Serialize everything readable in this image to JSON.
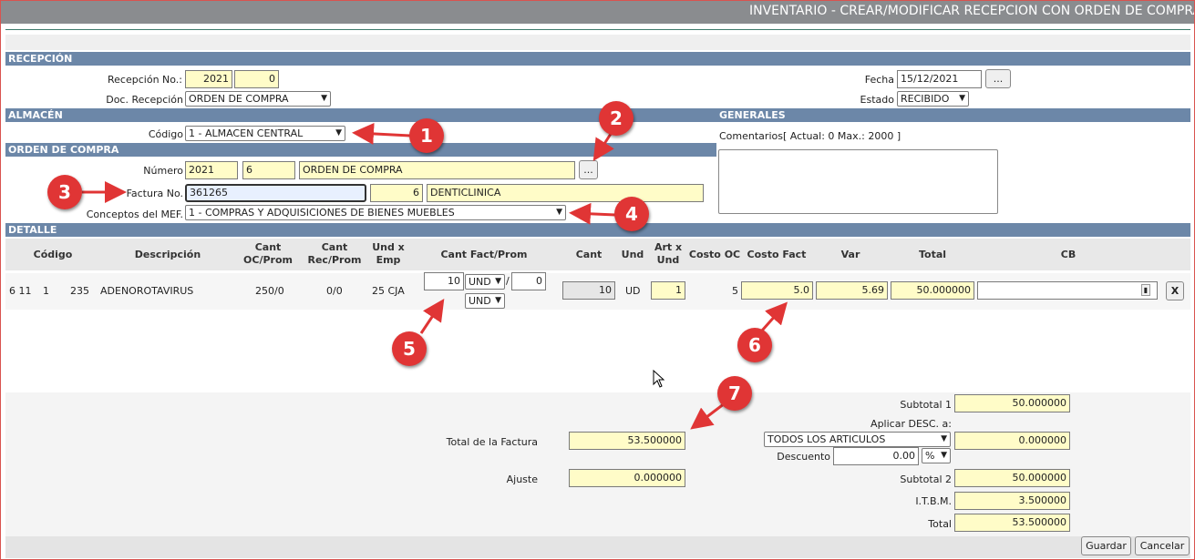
{
  "window": {
    "title": "INVENTARIO - CREAR/MODIFICAR RECEPCION CON ORDEN DE COMPRA"
  },
  "sections": {
    "recepcion": "RECEPCIÓN",
    "almacen": "ALMACÉN",
    "generales": "GENERALES",
    "orden": "ORDEN DE COMPRA",
    "detalle": "DETALLE"
  },
  "recepcion": {
    "numero_label": "Recepción No.:",
    "numero_year": "2021",
    "numero_seq": "0",
    "doc_label": "Doc. Recepción",
    "doc_value": "ORDEN DE COMPRA",
    "fecha_label": "Fecha",
    "fecha_value": "15/12/2021",
    "fecha_btn": "...",
    "estado_label": "Estado",
    "estado_value": "RECIBIDO"
  },
  "almacen": {
    "codigo_label": "Código",
    "codigo_value": "1 - ALMACEN CENTRAL"
  },
  "generales": {
    "comentarios_label": "Comentarios[ Actual: 0   Max.: 2000 ]",
    "comentarios_value": ""
  },
  "orden": {
    "numero_label": "Número",
    "numero_year": "2021",
    "numero_seq": "6",
    "numero_desc": "ORDEN DE COMPRA",
    "numero_btn": "...",
    "factura_label": "Factura No.",
    "factura_value": "361265",
    "proveedor_code": "6",
    "proveedor_name": "DENTICLINICA",
    "conceptos_label": "Conceptos del MEF.",
    "conceptos_value": "1 - COMPRAS Y ADQUISICIONES DE BIENES MUEBLES"
  },
  "detalle": {
    "columns": {
      "codigo": "Código",
      "descripcion": "Descripción",
      "cant_oc_1": "Cant",
      "cant_oc_2": "OC/Prom",
      "cant_rec_1": "Cant",
      "cant_rec_2": "Rec/Prom",
      "und_1": "Und x",
      "und_2": "Emp",
      "cant_fact": "Cant Fact/Prom",
      "cant": "Cant",
      "und": "Und",
      "art_1": "Art x",
      "art_2": "Und",
      "costo_oc": "Costo OC",
      "costo_fact": "Costo Fact",
      "var": "Var",
      "total": "Total",
      "cb": "CB"
    },
    "row": {
      "c1": "6 11",
      "c2": "1",
      "c3": "235",
      "descripcion": "ADENOROTAVIRUS",
      "cant_oc": "250/0",
      "cant_rec": "0/0",
      "und_emp": "25 CJA",
      "cant_fact": "10",
      "und_sel_1": "UND",
      "slash": "/",
      "cant_prom": "0",
      "und_sel_2": "UND",
      "cant": "10",
      "und": "UD",
      "art_x_und": "1",
      "costo_oc": "5",
      "costo_fact": "5.0",
      "var": "5.69",
      "total": "50.000000",
      "cb": "",
      "delete_btn": "X"
    }
  },
  "totales": {
    "total_factura_label": "Total de la Factura",
    "total_factura_value": "53.500000",
    "ajuste_label": "Ajuste",
    "ajuste_value": "0.000000",
    "subtotal1_label": "Subtotal 1",
    "subtotal1_value": "50.000000",
    "aplicar_label": "Aplicar DESC. a:",
    "aplicar_value": "TODOS LOS ARTICULOS",
    "aplicar_amount": "0.000000",
    "descuento_label": "Descuento",
    "descuento_value": "0.00",
    "descuento_unit": "%",
    "subtotal2_label": "Subtotal 2",
    "subtotal2_value": "50.000000",
    "itbm_label": "I.T.B.M.",
    "itbm_value": "3.500000",
    "total_label": "Total",
    "total_value": "53.500000"
  },
  "actions": {
    "guardar": "Guardar",
    "cancelar": "Cancelar"
  },
  "callouts": [
    "1",
    "2",
    "3",
    "4",
    "5",
    "6",
    "7"
  ],
  "colors": {
    "section_header": "#6c87a8",
    "input_yellow": "#fffcc8",
    "callout_red": "#e03535",
    "titlebar": "#8a8c8f"
  }
}
